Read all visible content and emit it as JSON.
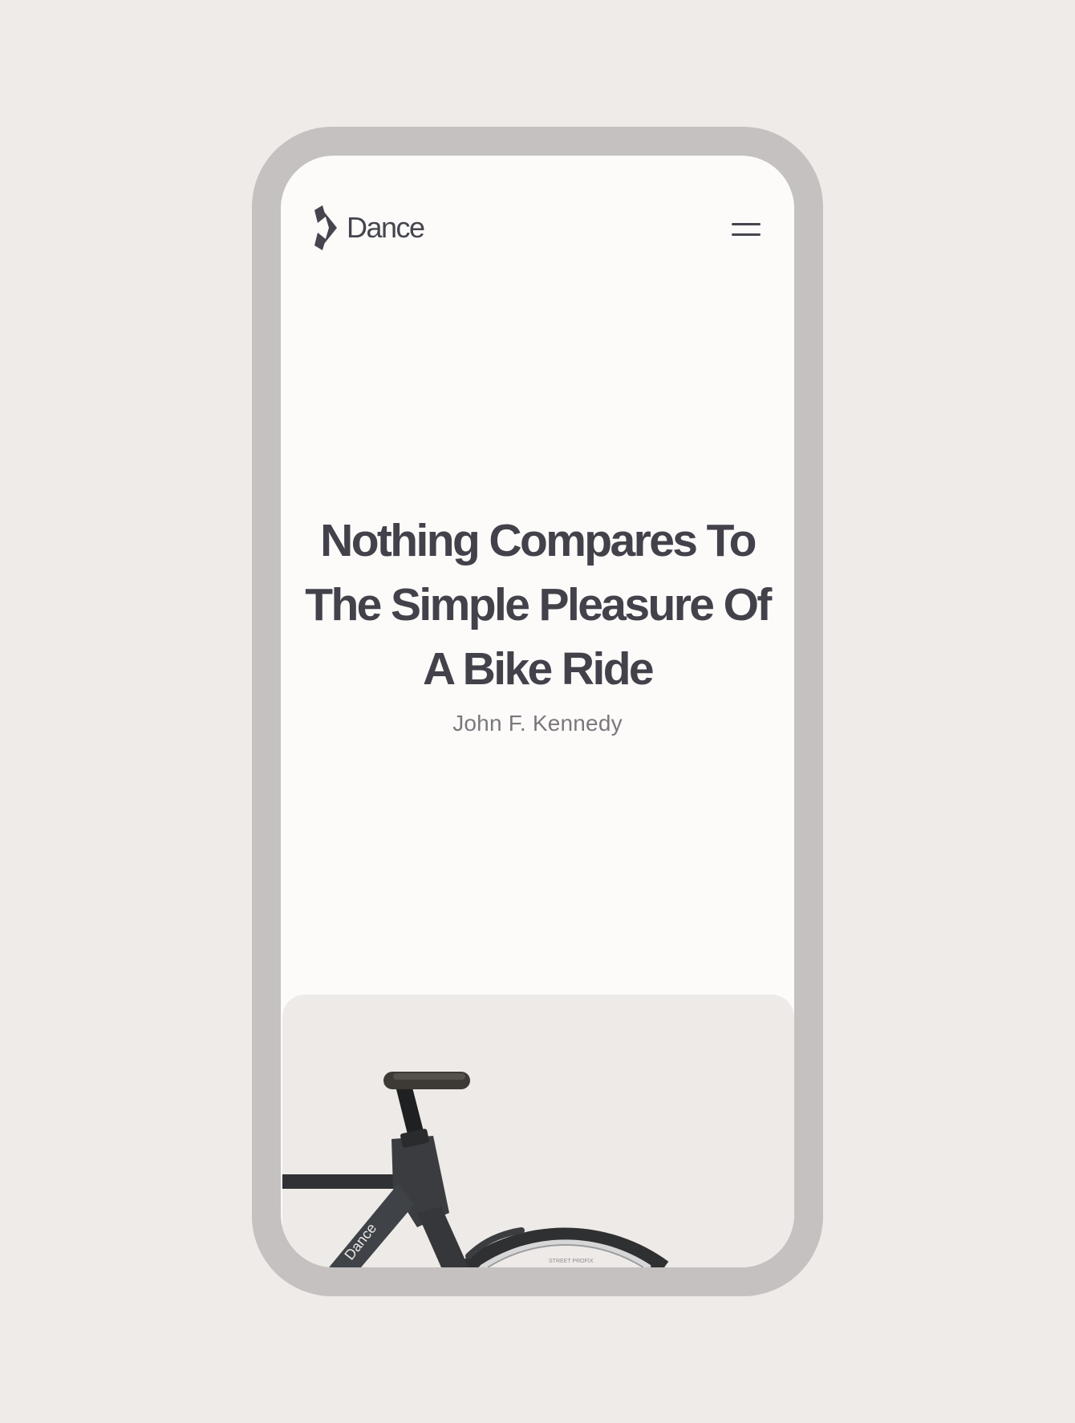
{
  "brand": {
    "name": "Dance",
    "logo_icon": "dance-logo-icon"
  },
  "nav": {
    "menu_icon": "hamburger-menu-icon"
  },
  "hero": {
    "quote": "Nothing Compares To The Simple Pleasure Of A Bike Ride",
    "author": "John F. Kennedy"
  },
  "bike_panel": {
    "image": "bike-frame-image",
    "frame_label": "Dance",
    "tire_label": "STREET PROFIX"
  },
  "colors": {
    "background": "#efebe8",
    "frame": "#c5c1c1",
    "screen": "#fcfbfa",
    "text_primary": "#43414a",
    "text_secondary": "#7a787c",
    "bike_panel": "#eeeae7"
  }
}
